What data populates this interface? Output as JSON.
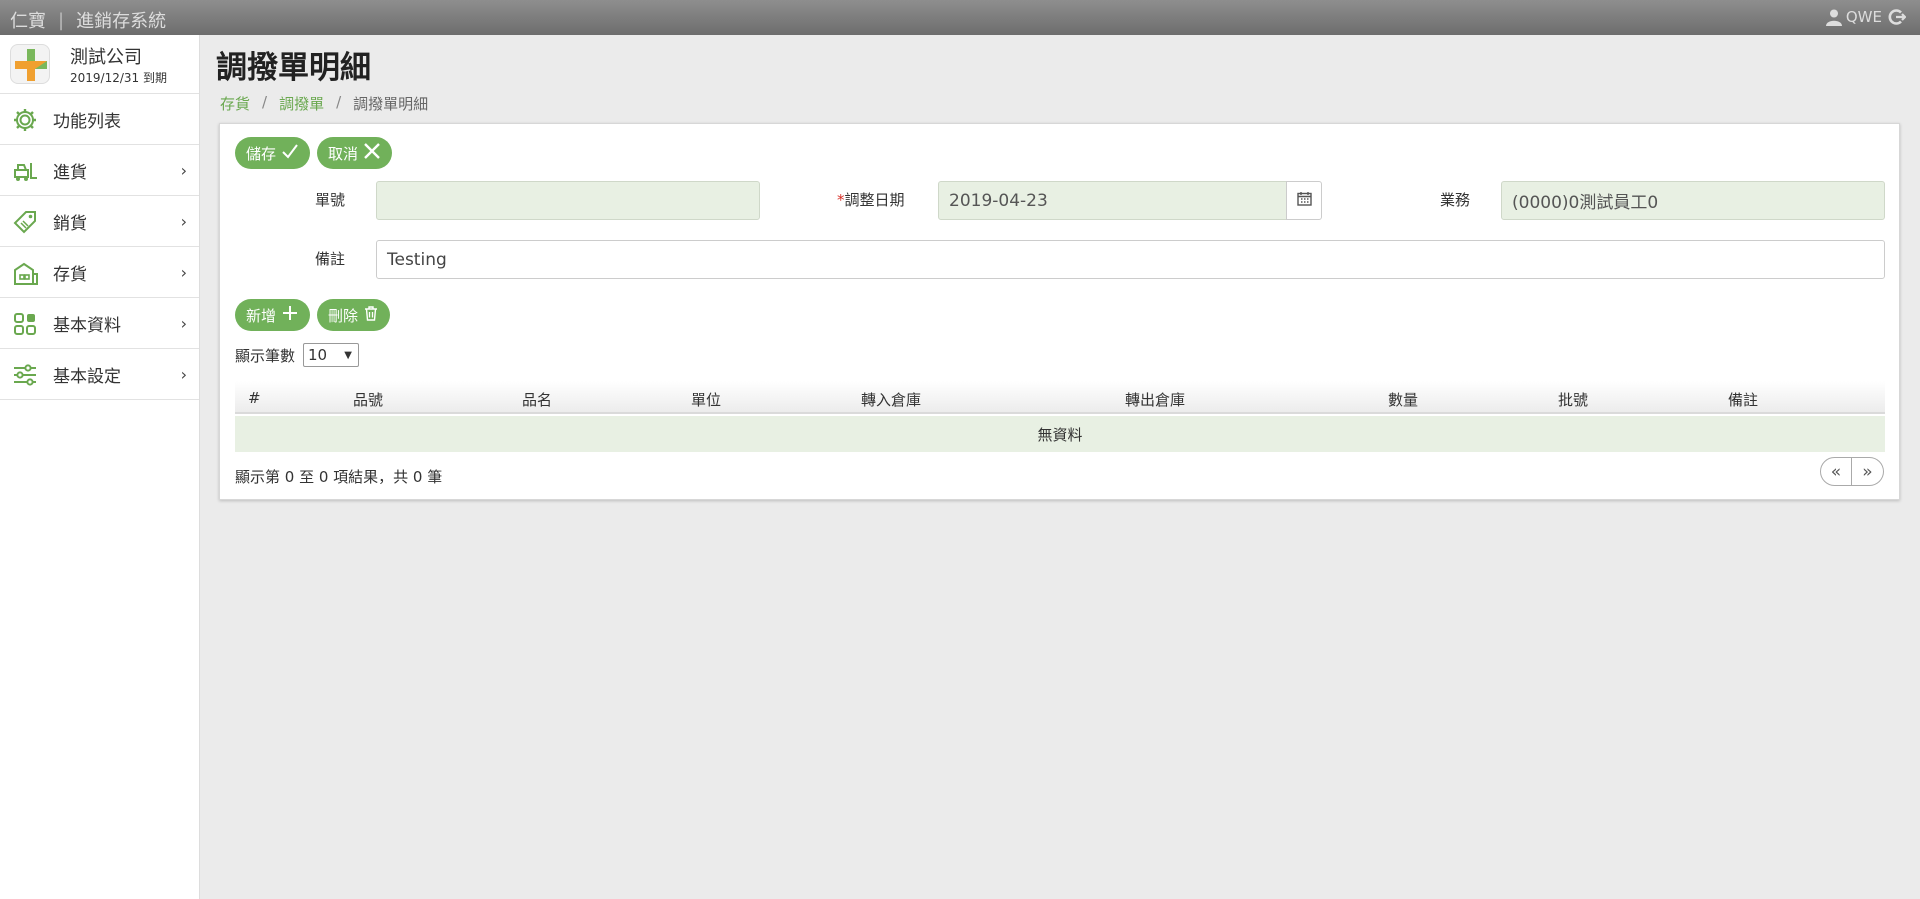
{
  "topbar": {
    "brand": "仁寶",
    "separator": "|",
    "system": "進銷存系統",
    "user": "QWE"
  },
  "sidebar": {
    "company_name": "測試公司",
    "expiry": "2019/12/31 到期",
    "items": [
      {
        "label": "功能列表",
        "icon": "gear-icon",
        "has_submenu": false
      },
      {
        "label": "進貨",
        "icon": "forklift-icon",
        "has_submenu": true
      },
      {
        "label": "銷貨",
        "icon": "tag-icon",
        "has_submenu": true
      },
      {
        "label": "存貨",
        "icon": "warehouse-icon",
        "has_submenu": true
      },
      {
        "label": "基本資料",
        "icon": "grid-icon",
        "has_submenu": true
      },
      {
        "label": "基本設定",
        "icon": "sliders-icon",
        "has_submenu": true
      }
    ],
    "chevron": "›"
  },
  "page": {
    "title": "調撥單明細",
    "breadcrumb": [
      "存貨",
      "調撥單",
      "調撥單明細"
    ],
    "breadcrumb_sep": "/"
  },
  "toolbar": {
    "save_label": "儲存",
    "cancel_label": "取消"
  },
  "form": {
    "order_no_label": "單號",
    "order_no_value": "",
    "date_required_mark": "*",
    "date_label": "調整日期",
    "date_value": "2019-04-23",
    "staff_label": "業務",
    "staff_value": "(0000)0測試員工0",
    "note_label": "備註",
    "note_value": "Testing"
  },
  "detail_toolbar": {
    "add_label": "新增",
    "delete_label": "刪除"
  },
  "table": {
    "page_size_label": "顯示筆數",
    "page_size": "10",
    "columns": [
      "#",
      "品號",
      "品名",
      "單位",
      "轉入倉庫",
      "轉出倉庫",
      "數量",
      "批號",
      "備註"
    ],
    "empty_text": "無資料",
    "info": "顯示第 0 至 0 項結果，共 0 筆"
  },
  "pager": {
    "prev": "«",
    "next": "»"
  },
  "colors": {
    "accent": "#71b15a",
    "link": "#6aa84f",
    "field_bg": "#e8f0e3",
    "required": "#d9322a"
  }
}
